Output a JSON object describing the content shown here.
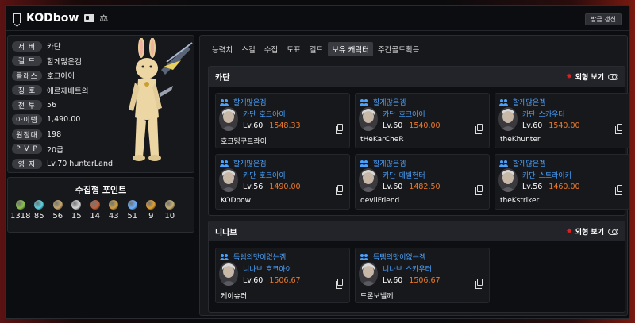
{
  "header": {
    "char_name": "KODbow",
    "refresh_label": "방금 갱신"
  },
  "profile": {
    "rows": [
      {
        "label": "서 버",
        "value": "카단"
      },
      {
        "label": "길 드",
        "value": "할게많은겜"
      },
      {
        "label": "클래스",
        "value": "호크아이"
      },
      {
        "label": "칭 호",
        "value": "에르제베트의"
      },
      {
        "label": "전 투",
        "value": "56"
      },
      {
        "label": "아이템",
        "value": "1,490.00"
      },
      {
        "label": "원정대",
        "value": "198"
      },
      {
        "label": "P V P",
        "value": "20급"
      },
      {
        "label": "영 지",
        "value": "Lv.70 hunterLand"
      }
    ]
  },
  "collect": {
    "title": "수집형 포인트",
    "items": [
      {
        "icon": "mokoko-seed-icon",
        "count": "1318",
        "color": "#8bc34a"
      },
      {
        "icon": "island-heart-icon",
        "count": "85",
        "color": "#5ad1e0"
      },
      {
        "icon": "great-art-icon",
        "count": "56",
        "color": "#c9a86a"
      },
      {
        "icon": "giant-heart-icon",
        "count": "15",
        "color": "#d8d8d8"
      },
      {
        "icon": "ignea-token-icon",
        "count": "14",
        "color": "#c0603a"
      },
      {
        "icon": "adventure-chronicle-icon",
        "count": "43",
        "color": "#d0a040"
      },
      {
        "icon": "world-tree-leaf-icon",
        "count": "51",
        "color": "#6ab0ff"
      },
      {
        "icon": "orpheus-star-icon",
        "count": "9",
        "color": "#e0a030"
      },
      {
        "icon": "sea-bounty-icon",
        "count": "10",
        "color": "#c8b070"
      }
    ]
  },
  "tabs": [
    "능력치",
    "스킬",
    "수집",
    "도표",
    "길드",
    "보유 캐릭터",
    "주간골드획득"
  ],
  "active_tab": 5,
  "look_label": "외형 보기",
  "servers": [
    {
      "name": "카단",
      "characters": [
        {
          "guild": "할게많은겜",
          "server": "카단",
          "class": "호크아이",
          "level": "Lv.60",
          "item_level": "1548.33",
          "name": "호크밍구트롸이"
        },
        {
          "guild": "할게많은겜",
          "server": "카단",
          "class": "호크아이",
          "level": "Lv.60",
          "item_level": "1540.00",
          "name": "tHeKarCheR"
        },
        {
          "guild": "할게많은겜",
          "server": "카단",
          "class": "스카우터",
          "level": "Lv.60",
          "item_level": "1540.00",
          "name": "theKhunter"
        },
        {
          "guild": "할게많은겜",
          "server": "카단",
          "class": "호크아이",
          "level": "Lv.56",
          "item_level": "1490.00",
          "name": "KODbow"
        },
        {
          "guild": "할게많은겜",
          "server": "카단",
          "class": "데빌헌터",
          "level": "Lv.60",
          "item_level": "1482.50",
          "name": "devilFriend"
        },
        {
          "guild": "할게많은겜",
          "server": "카단",
          "class": "스트라이커",
          "level": "Lv.56",
          "item_level": "1460.00",
          "name": "theKstriker"
        }
      ]
    },
    {
      "name": "니나브",
      "characters": [
        {
          "guild": "득템의맛이없는겜",
          "server": "니나브",
          "class": "호크아이",
          "level": "Lv.60",
          "item_level": "1506.67",
          "name": "케이슈러"
        },
        {
          "guild": "득템의맛이없는겜",
          "server": "니나브",
          "class": "스카우터",
          "level": "Lv.60",
          "item_level": "1506.67",
          "name": "드론보낼께"
        }
      ]
    }
  ]
}
